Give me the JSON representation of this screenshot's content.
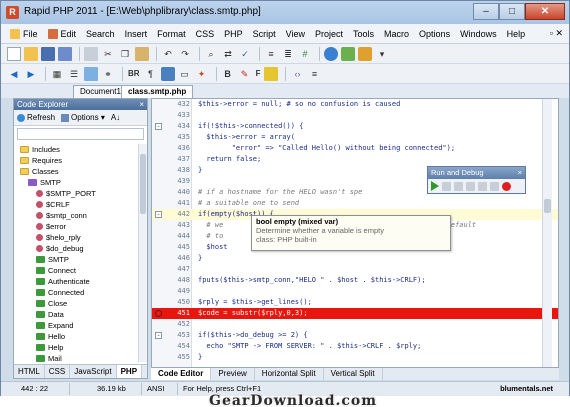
{
  "window": {
    "title": "Rapid PHP 2011 - [E:\\Web\\phplibrary\\class.smtp.php]",
    "minimize_glyph": "–",
    "maximize_glyph": "□",
    "close_glyph": "✕"
  },
  "menubar": {
    "items": [
      "File",
      "Edit",
      "Search",
      "Insert",
      "Format",
      "CSS",
      "PHP",
      "Script",
      "View",
      "Project",
      "Tools",
      "Macro",
      "Options",
      "Windows",
      "Help"
    ],
    "right_glyphs": "▫ ✕"
  },
  "toolbar2": {
    "br_label": "BR",
    "font_label": "F"
  },
  "doc_tabs": {
    "tabs": [
      "Document1",
      "class.smtp.php"
    ],
    "active_index": 1
  },
  "code_explorer": {
    "title": "Code Explorer",
    "close_glyph": "×",
    "refresh_label": "Refresh",
    "options_label": "Options",
    "sort_label": "A↓",
    "tree": [
      {
        "label": "Includes",
        "type": "folder",
        "depth": 1
      },
      {
        "label": "Requires",
        "type": "folder",
        "depth": 1
      },
      {
        "label": "Classes",
        "type": "folder",
        "depth": 1
      },
      {
        "label": "SMTP",
        "type": "class",
        "depth": 2
      },
      {
        "label": "$SMTP_PORT",
        "type": "var",
        "depth": 3
      },
      {
        "label": "$CRLF",
        "type": "var",
        "depth": 3
      },
      {
        "label": "$smtp_conn",
        "type": "var",
        "depth": 3
      },
      {
        "label": "$error",
        "type": "var",
        "depth": 3
      },
      {
        "label": "$helo_rply",
        "type": "var",
        "depth": 3
      },
      {
        "label": "$do_debug",
        "type": "var",
        "depth": 3
      },
      {
        "label": "SMTP",
        "type": "fn",
        "depth": 3
      },
      {
        "label": "Connect",
        "type": "fn",
        "depth": 3
      },
      {
        "label": "Authenticate",
        "type": "fn",
        "depth": 3
      },
      {
        "label": "Connected",
        "type": "fn",
        "depth": 3
      },
      {
        "label": "Close",
        "type": "fn",
        "depth": 3
      },
      {
        "label": "Data",
        "type": "fn",
        "depth": 3
      },
      {
        "label": "Expand",
        "type": "fn",
        "depth": 3
      },
      {
        "label": "Hello",
        "type": "fn",
        "depth": 3
      },
      {
        "label": "Help",
        "type": "fn",
        "depth": 3
      },
      {
        "label": "Mail",
        "type": "fn",
        "depth": 3
      }
    ],
    "lang_tabs": [
      "HTML",
      "CSS",
      "JavaScript",
      "PHP"
    ],
    "active_lang_index": 3
  },
  "editor": {
    "lines": [
      {
        "num": "432",
        "text": "$this->error = null; # so no confusion is caused",
        "kind": "code"
      },
      {
        "num": "433",
        "text": "",
        "kind": "code"
      },
      {
        "num": "434",
        "text": "if(!$this->connected()) {",
        "kind": "code",
        "fold": "-"
      },
      {
        "num": "435",
        "text": "  $this->error = array(",
        "kind": "code"
      },
      {
        "num": "436",
        "text": "        \"error\" => \"Called Hello() without being connected\");",
        "kind": "code"
      },
      {
        "num": "437",
        "text": "  return false;",
        "kind": "code"
      },
      {
        "num": "438",
        "text": "}",
        "kind": "code"
      },
      {
        "num": "439",
        "text": "",
        "kind": "code"
      },
      {
        "num": "440",
        "text": "# if a hostname for the HELO wasn't spe",
        "kind": "comment"
      },
      {
        "num": "441",
        "text": "# a suitable one to send",
        "kind": "comment"
      },
      {
        "num": "442",
        "text": "if(empty($host)) {",
        "kind": "current",
        "fold": "-"
      },
      {
        "num": "443",
        "text": "  # we                                          appropiate default",
        "kind": "comment"
      },
      {
        "num": "444",
        "text": "  # to",
        "kind": "comment"
      },
      {
        "num": "445",
        "text": "  $host",
        "kind": "code"
      },
      {
        "num": "446",
        "text": "}",
        "kind": "code"
      },
      {
        "num": "447",
        "text": "",
        "kind": "code"
      },
      {
        "num": "448",
        "text": "fputs($this->smtp_conn,\"HELO \" . $host . $this->CRLF);",
        "kind": "code"
      },
      {
        "num": "449",
        "text": "",
        "kind": "code"
      },
      {
        "num": "450",
        "text": "$rply = $this->get_lines();",
        "kind": "code"
      },
      {
        "num": "451",
        "text": "$code = substr($rply,0,3);",
        "kind": "error",
        "breakpoint": true
      },
      {
        "num": "452",
        "text": "",
        "kind": "code"
      },
      {
        "num": "453",
        "text": "if($this->do_debug >= 2) {",
        "kind": "code",
        "fold": "-"
      },
      {
        "num": "454",
        "text": "  echo \"SMTP -> FROM SERVER: \" . $this->CRLF . $rply;",
        "kind": "code"
      },
      {
        "num": "455",
        "text": "}",
        "kind": "code"
      }
    ],
    "tooltip": {
      "signature": "bool empty (mixed var)",
      "description": "Determine whether a variable is empty",
      "class_line": "class: PHP built-in"
    },
    "view_tabs": [
      "Code Editor",
      "Preview",
      "Horizontal Split",
      "Vertical Split"
    ],
    "active_view_index": 0
  },
  "run_debug": {
    "title": "Run and Debug",
    "close_glyph": "×"
  },
  "statusbar": {
    "position": "442 : 22",
    "size": "36.19 kb",
    "encoding": "ANSI",
    "help": "For Help, press Ctrl+F1",
    "brand": "blumentals.net"
  },
  "watermark": "GearDownload.com",
  "colors": {
    "error_line": "#e8160f",
    "current_line": "#fffbd4",
    "accent": "#5d7fab"
  }
}
